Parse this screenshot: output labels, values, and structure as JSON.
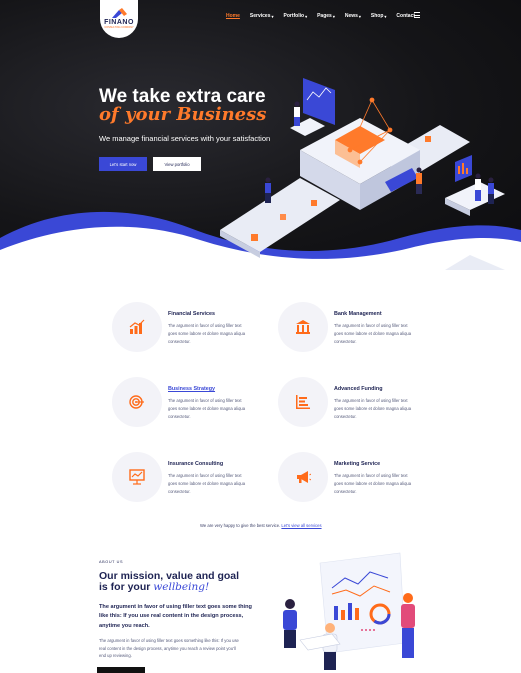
{
  "brand": {
    "name": "FINANO",
    "tagline": "CONSULTING COMPANY"
  },
  "nav": {
    "items": [
      {
        "label": "Home",
        "active": true,
        "caret": false
      },
      {
        "label": "Services",
        "active": false,
        "caret": true
      },
      {
        "label": "Portfolio",
        "active": false,
        "caret": true
      },
      {
        "label": "Pages",
        "active": false,
        "caret": true
      },
      {
        "label": "News",
        "active": false,
        "caret": true
      },
      {
        "label": "Shop",
        "active": false,
        "caret": true
      },
      {
        "label": "Contact",
        "active": false,
        "caret": false
      }
    ],
    "caret_glyph": "▾",
    "menu_icon": "hamburger-icon"
  },
  "hero": {
    "title_line1": "We take extra care",
    "title_line2": "of your Business",
    "subtitle": "We manage financial services with your satisfaction",
    "primary_button": "Let's start now",
    "secondary_button": "View portfolio"
  },
  "services": [
    {
      "title": "Financial Services",
      "icon": "bar-chart-icon",
      "highlighted": false,
      "desc": "The argument in favor of using filler text goes some labore et dolore magna aliqua consectetur."
    },
    {
      "title": "Bank Management",
      "icon": "bank-icon",
      "highlighted": false,
      "desc": "The argument in favor of using filler text goes some labore et dolore magna aliqua consectetur."
    },
    {
      "title": "Business Strategy",
      "icon": "target-icon",
      "highlighted": true,
      "desc": "The argument in favor of using filler text goes some labore et dolore magna aliqua consectetur."
    },
    {
      "title": "Advanced Funding",
      "icon": "growth-chart-icon",
      "highlighted": false,
      "desc": "The argument in favor of using filler text goes some labore et dolore magna aliqua consectetur."
    },
    {
      "title": "Insurance Consulting",
      "icon": "presentation-board-icon",
      "highlighted": false,
      "desc": "The argument in favor of using filler text goes some labore et dolore magna aliqua consectetur."
    },
    {
      "title": "Marketing Service",
      "icon": "megaphone-icon",
      "highlighted": false,
      "desc": "The argument in favor of using filler text goes some labore et dolore magna aliqua consectetur."
    }
  ],
  "services_footer": {
    "text": "We are very happy to give the best service.",
    "link": "Let's view all services"
  },
  "about": {
    "label": "ABOUT US",
    "title_line1": "Our mission, value and goal",
    "title_line2_prefix": "is for your ",
    "title_line2_emph": "wellbeing!",
    "lead": "The argument in favor of using filler text goes some thing like this: If you use real content in the design process, anytime you reach.",
    "body": "The argument in favor of using filler text goes something like this: If you use real content in the design process, anytime you reach a review point you'll end up reviewing."
  },
  "colors": {
    "accent": "#ff7a2b",
    "primary": "#3a48d6",
    "navy": "#1e2353",
    "hero_bg": "#151518"
  }
}
